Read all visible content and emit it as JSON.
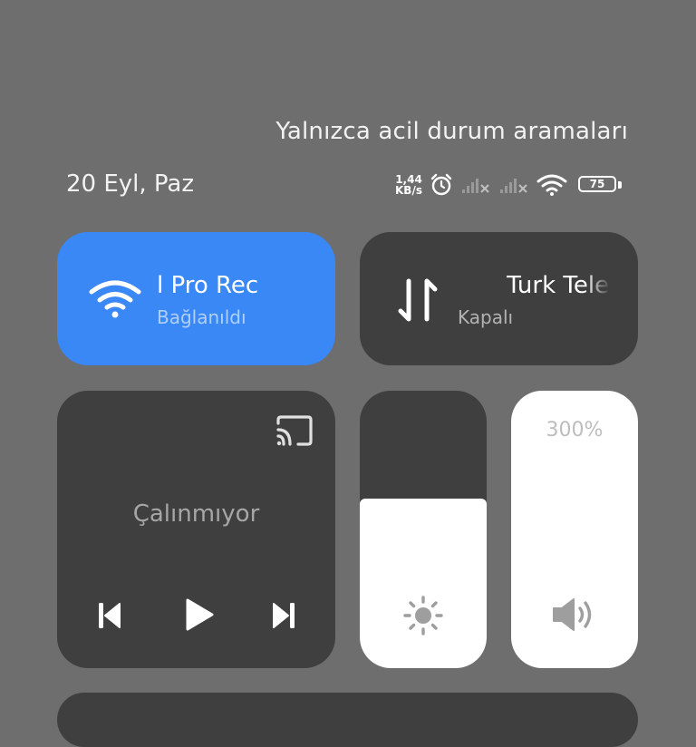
{
  "status_bar": {
    "emergency_text": "Yalnızca acil durum aramaları",
    "date": "20 Eyl, Paz",
    "net_speed_value": "1,44",
    "net_speed_unit": "KB/s",
    "battery_level": "75"
  },
  "wifi_tile": {
    "title": "l Pro       Rec",
    "status": "Bağlanıldı",
    "color": "#3a87f6"
  },
  "mobile_data_tile": {
    "title": "Turk Tele",
    "status": "Kapalı"
  },
  "media_tile": {
    "title": "Çalınmıyor"
  },
  "brightness": {
    "level_fraction": 0.61
  },
  "volume": {
    "label": "300%",
    "level_fraction": 1.0
  },
  "icons": {
    "net_speed": "network-speed-icon",
    "alarm": "alarm-clock-icon",
    "signal1": "signal-no-service-icon",
    "signal2": "signal-no-service-icon",
    "wifi_status": "wifi-icon",
    "battery": "battery-icon",
    "wifi_tile": "wifi-icon",
    "mobile_data": "mobile-data-icon",
    "cast": "cast-icon",
    "prev": "skip-previous-icon",
    "play": "play-icon",
    "next": "skip-next-icon",
    "brightness": "sun-icon",
    "volume": "speaker-icon"
  }
}
